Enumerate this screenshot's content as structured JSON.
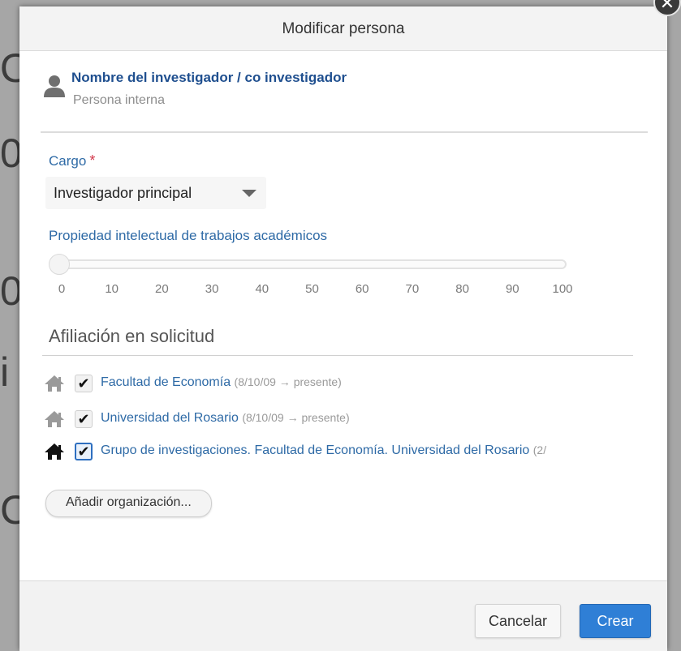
{
  "modal": {
    "title": "Modificar persona"
  },
  "person": {
    "name": "Nombre del investigador / co investigador",
    "type": "Persona interna"
  },
  "cargo": {
    "label": "Cargo",
    "required_mark": "*",
    "selected": "Investigador principal"
  },
  "property": {
    "label": "Propiedad intelectual de trabajos académicos",
    "value": 0,
    "ticks": [
      "0",
      "10",
      "20",
      "30",
      "40",
      "50",
      "60",
      "70",
      "80",
      "90",
      "100"
    ]
  },
  "affiliation": {
    "title": "Afiliación en solicitud",
    "orgs": [
      {
        "name": "Facultad de Economía",
        "date": "(8/10/09 → presente)",
        "checked": true
      },
      {
        "name": "Universidad del Rosario",
        "date": "(8/10/09 → presente)",
        "checked": true
      },
      {
        "name": "Grupo de investigaciones. Facultad de Economía. Universidad del Rosario",
        "date": "(2/",
        "checked": true
      }
    ],
    "add_button": "Añadir organización..."
  },
  "footer": {
    "cancel": "Cancelar",
    "create": "Crear"
  },
  "colors": {
    "accent": "#2f7fd6",
    "label_blue": "#2e6aa6",
    "required_red": "#d2374a"
  }
}
